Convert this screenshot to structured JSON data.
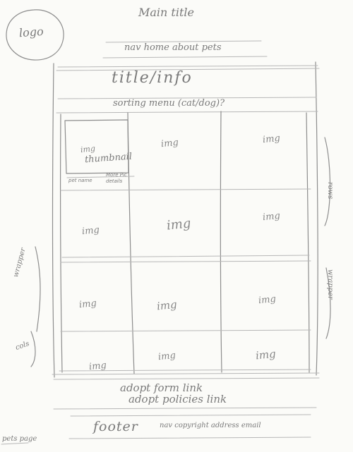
{
  "main_title": "Main title",
  "logo": "logo",
  "nav": "nav home about pets",
  "title_info": "title/info",
  "sorting_menu": "sorting menu (cat/dog)?",
  "grid": {
    "thumbnail_cell": {
      "img": "img",
      "caption": "thumbnail",
      "meta_left": "pet name",
      "meta_right": "More Pic details"
    },
    "cells": [
      "img",
      "img",
      "img",
      "img",
      "img",
      "img",
      "img",
      "img",
      "img",
      "img",
      "img"
    ]
  },
  "margin_notes": {
    "left_top": "wrapper",
    "left_bottom": "cols",
    "right_top": "rows",
    "right_bottom": "wrapper"
  },
  "adopt_form_link": "adopt form link",
  "adopt_policies_link": "adopt policies link",
  "footer": {
    "label": "footer",
    "details": "nav copyright address email"
  },
  "page_label": "pets page"
}
